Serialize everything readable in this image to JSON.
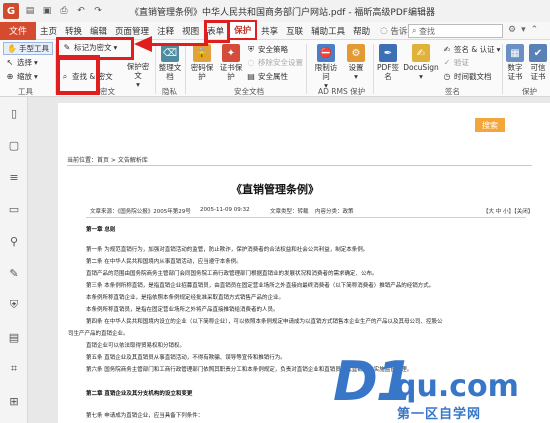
{
  "window": {
    "title": "《直销管理条例》中华人民共和国商务部门户网站.pdf - 福昕高级PDF编辑器"
  },
  "menu": {
    "file": "文件",
    "tabs": [
      "主页",
      "转换",
      "编辑",
      "页面管理",
      "注释",
      "视图",
      "表单",
      "保护",
      "共享",
      "互联",
      "辅助工具",
      "帮助"
    ],
    "active_tab": "保护",
    "tell_me": "告诉我...",
    "search_placeholder": "查找"
  },
  "ribbon": {
    "tools": {
      "hand": "手型工具",
      "select": "选择",
      "zoom": "缩放",
      "group": "工具"
    },
    "redact": {
      "mark": "标记为密文",
      "find_redact": "查找 & 密文",
      "apply": "应用密文",
      "protect_redact": "保护密文",
      "group": "密文"
    },
    "cleanup": {
      "label": "整理文档",
      "group": "隐私"
    },
    "password": {
      "label": "密码保护"
    },
    "cert": {
      "label": "证书保护"
    },
    "secure": {
      "policy": "安全策略",
      "remove": "移除安全设置",
      "props": "安全属性",
      "group": "安全文档"
    },
    "rms": {
      "limit": "限制访问",
      "settings": "设置",
      "group": "AD RMS 保护"
    },
    "sign": {
      "pdf_sign": "PDF签名",
      "docusign": "DocuSign",
      "sign_cert": "签名 & 认证",
      "validate": "验证",
      "timestamp": "时间戳文档",
      "group": "签名"
    },
    "digital": {
      "id": "数字证书",
      "trusted": "可信证书",
      "group": "保护"
    }
  },
  "document": {
    "search_button": "搜索",
    "breadcrumb": "当前位置：首页 > 文告解析库",
    "title": "《直销管理条例》",
    "meta": {
      "source": "文章来源：《国务院公报》2005年第29号",
      "date": "2005-11-09 09:32",
      "type": "文章类型：转载",
      "category": "内容分类：政策",
      "font_size": "【大 中 小】【关闭】"
    },
    "lines": [
      "第一章 总则",
      "第一条 为规范直销行为，加强对直销活动的监管，防止欺诈，保护消费者的合法权益和社会公共利益，制定本条例。",
      "第二条 在中华人民共和国境内从事直销活动，应当遵守本条例。",
      "直销产品的范围由国务院商务主管部门会同国务院工商行政管理部门根据直销业的发展状况和消费者的需求确定、公布。",
      "第三条 本条例所称直销，是指直销企业招募直销员，由直销员在固定营业场所之外直接向最终消费者（以下简称消费者）推销产品的经销方式。",
      "本条例所称直销企业，是指依照本条例规定经批准采取直销方式销售产品的企业。",
      "本条例所称直销员，是指在固定营业场所之外将产品直接推销给消费者的人员。",
      "第四条 在中华人民共和国境内设立的企业（以下简称企业），可以依照本条例规定申请成为以直销方式销售本企业生产的产品以及其母公司、控股公",
      "司生产产品的直销企业。",
      "直销企业可以依法取得贸易权和分销权。",
      "第五条 直销企业及其直销员从事直销活动，不得有欺骗、误导等宣传和推销行为。",
      "第六条 国务院商务主管部门和工商行政管理部门依照其职责分工和本条例规定，负责对直销企业和直销员及其直销活动实施监督管理。",
      "第二章 直销企业及其分支机构的设立和变更",
      "第七条 申请成为直销企业，应当具备下列条件："
    ]
  },
  "watermark": {
    "main": "D1",
    "domain": "qu.com",
    "sub": "第一区自学网"
  }
}
